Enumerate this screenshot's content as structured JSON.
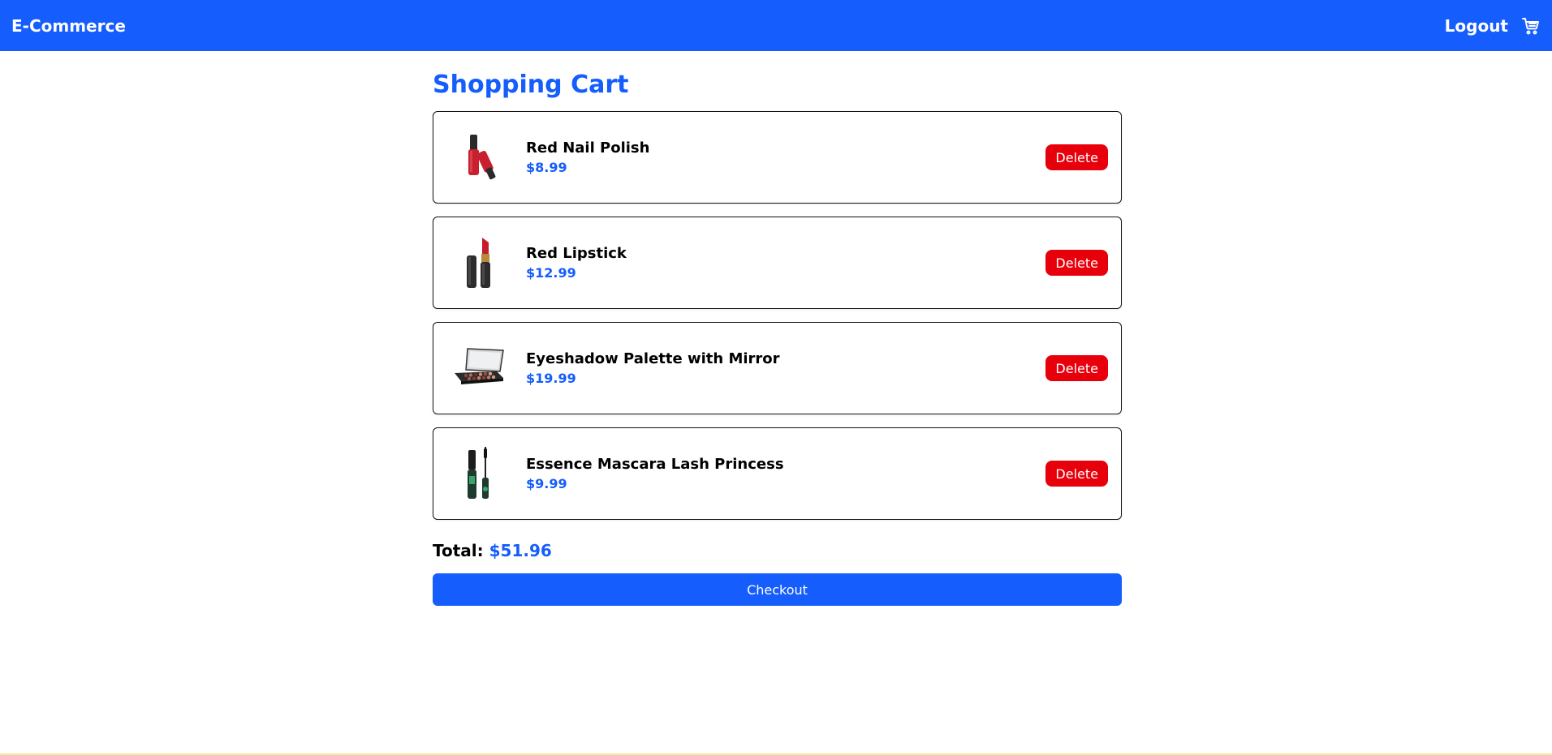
{
  "navbar": {
    "brand": "E-Commerce",
    "logout_label": "Logout",
    "cart_icon": "shopping-cart-icon"
  },
  "main": {
    "title": "Shopping Cart",
    "items": [
      {
        "name": "Red Nail Polish",
        "price": "$8.99",
        "delete_label": "Delete",
        "image": "nail-polish-image"
      },
      {
        "name": "Red Lipstick",
        "price": "$12.99",
        "delete_label": "Delete",
        "image": "lipstick-image"
      },
      {
        "name": "Eyeshadow Palette with Mirror",
        "price": "$19.99",
        "delete_label": "Delete",
        "image": "eyeshadow-palette-image"
      },
      {
        "name": "Essence Mascara Lash Princess",
        "price": "$9.99",
        "delete_label": "Delete",
        "image": "mascara-image"
      }
    ],
    "total_label": "Total:",
    "total_value": "$51.96",
    "checkout_label": "Checkout"
  },
  "colors": {
    "primary": "#155dfc",
    "danger": "#e7000b"
  }
}
